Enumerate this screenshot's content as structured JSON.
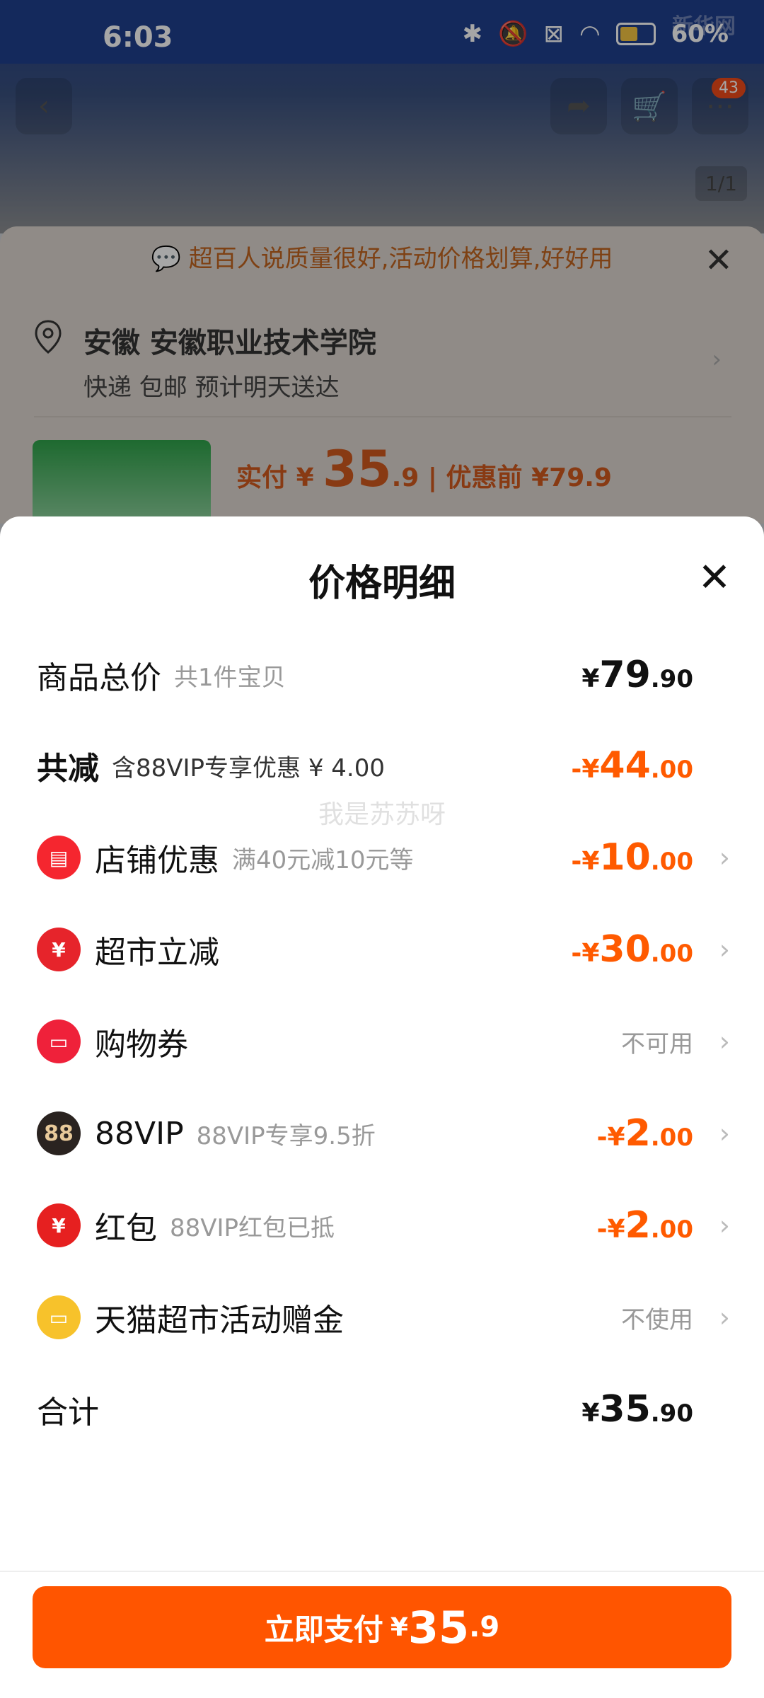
{
  "status": {
    "time": "6:03",
    "battery": "60%",
    "logo": "新华网"
  },
  "background": {
    "cart_count": "43",
    "page_count": "1/1",
    "promo_text": "超百人说质量很好,活动价格划算,好好用",
    "address_main": "安徽 安徽职业技术学院",
    "address_sub": "快递 包邮 预计明天送达",
    "price_label": "实付",
    "price_currency": "¥",
    "price_int": "35",
    "price_dec": ".9",
    "price_before": "| 优惠前 ¥79.9"
  },
  "sheet": {
    "title": "价格明细",
    "watermark": "我是苏苏呀",
    "total_price": {
      "label": "商品总价",
      "sub": "共1件宝贝",
      "currency": "¥",
      "int": "79",
      "dec": ".90"
    },
    "total_discount": {
      "label": "共减",
      "sub": "含88VIP专享优惠 ¥ 4.00",
      "prefix": "-¥",
      "int": "44",
      "dec": ".00"
    },
    "items": [
      {
        "icon": "store-icon",
        "label": "店铺优惠",
        "sub": "满40元减10元等",
        "prefix": "-¥",
        "int": "10",
        "dec": ".00"
      },
      {
        "icon": "yen-icon",
        "label": "超市立减",
        "sub": "",
        "prefix": "-¥",
        "int": "30",
        "dec": ".00"
      },
      {
        "icon": "ticket-icon",
        "label": "购物券",
        "sub": "",
        "status": "不可用"
      },
      {
        "icon": "vip-88-icon",
        "icon_text": "88",
        "label": "88VIP",
        "sub": "88VIP专享9.5折",
        "prefix": "-¥",
        "int": "2",
        "dec": ".00"
      },
      {
        "icon": "red-envelope-icon",
        "label": "红包",
        "sub": "88VIP红包已抵",
        "prefix": "-¥",
        "int": "2",
        "dec": ".00"
      },
      {
        "icon": "gift-card-icon",
        "label": "天猫超市活动赠金",
        "sub": "",
        "status": "不使用"
      }
    ],
    "sum": {
      "label": "合计",
      "currency": "¥",
      "int": "35",
      "dec": ".90"
    },
    "pay_button": {
      "label": "立即支付",
      "currency": "¥",
      "int": "35",
      "dec": ".9"
    }
  }
}
